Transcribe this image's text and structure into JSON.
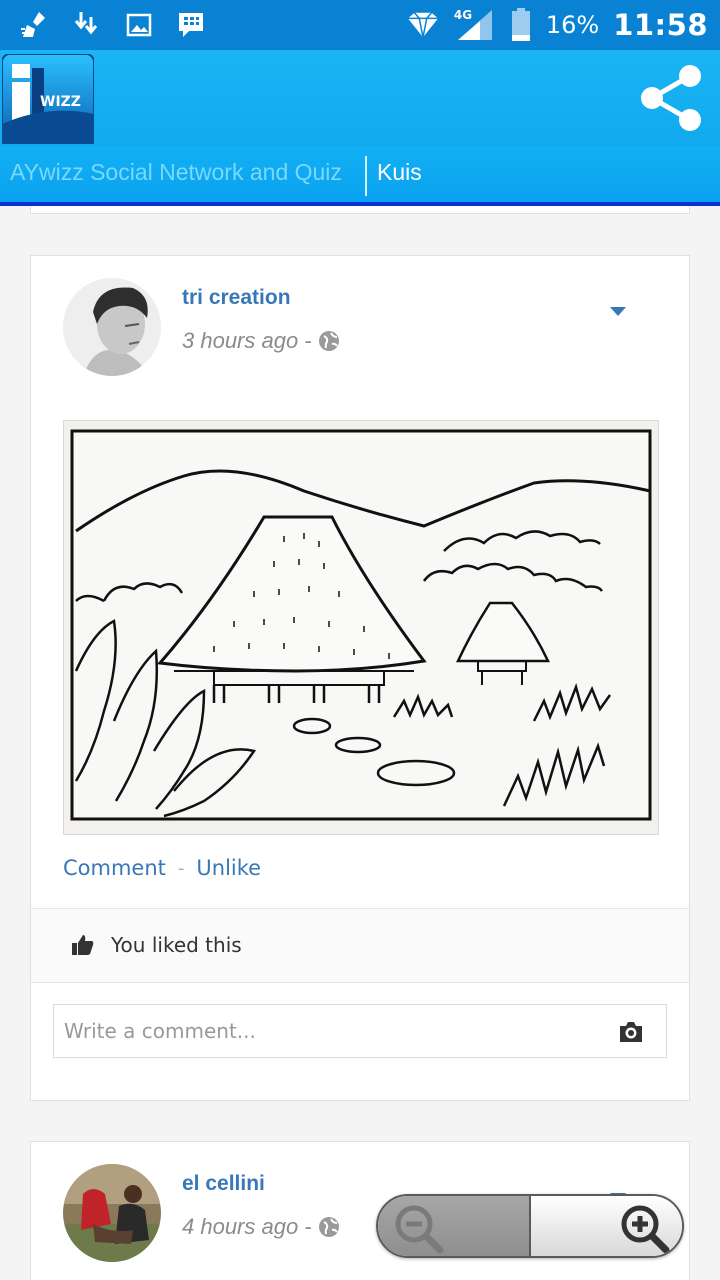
{
  "status_bar": {
    "battery": "16%",
    "time": "11:58",
    "network": "4G",
    "icons": [
      "cleaner-icon",
      "download-icon",
      "image-icon",
      "bbm-icon",
      "vpn-diamond-icon",
      "signal-icon",
      "battery-icon"
    ]
  },
  "header": {
    "logo_text": "WIZZ",
    "share_icon": "share-icon"
  },
  "tabs": [
    {
      "label": "AYwizz Social Network and Quiz"
    },
    {
      "label": "Kuis"
    }
  ],
  "posts": [
    {
      "author": "tri creation",
      "time": "3 hours ago",
      "separator": "-",
      "actions": {
        "comment": "Comment",
        "separator": "-",
        "unlike": "Unlike"
      },
      "likes_text": "You liked this",
      "comment_placeholder": "Write a comment..."
    },
    {
      "author": "el cellini",
      "time": "4 hours ago",
      "separator": "-"
    }
  ],
  "colors": {
    "status_bar": "#0a82d4",
    "header": "#19b5f4",
    "link": "#3978b8",
    "tab_underline": "#0a2fd4"
  }
}
